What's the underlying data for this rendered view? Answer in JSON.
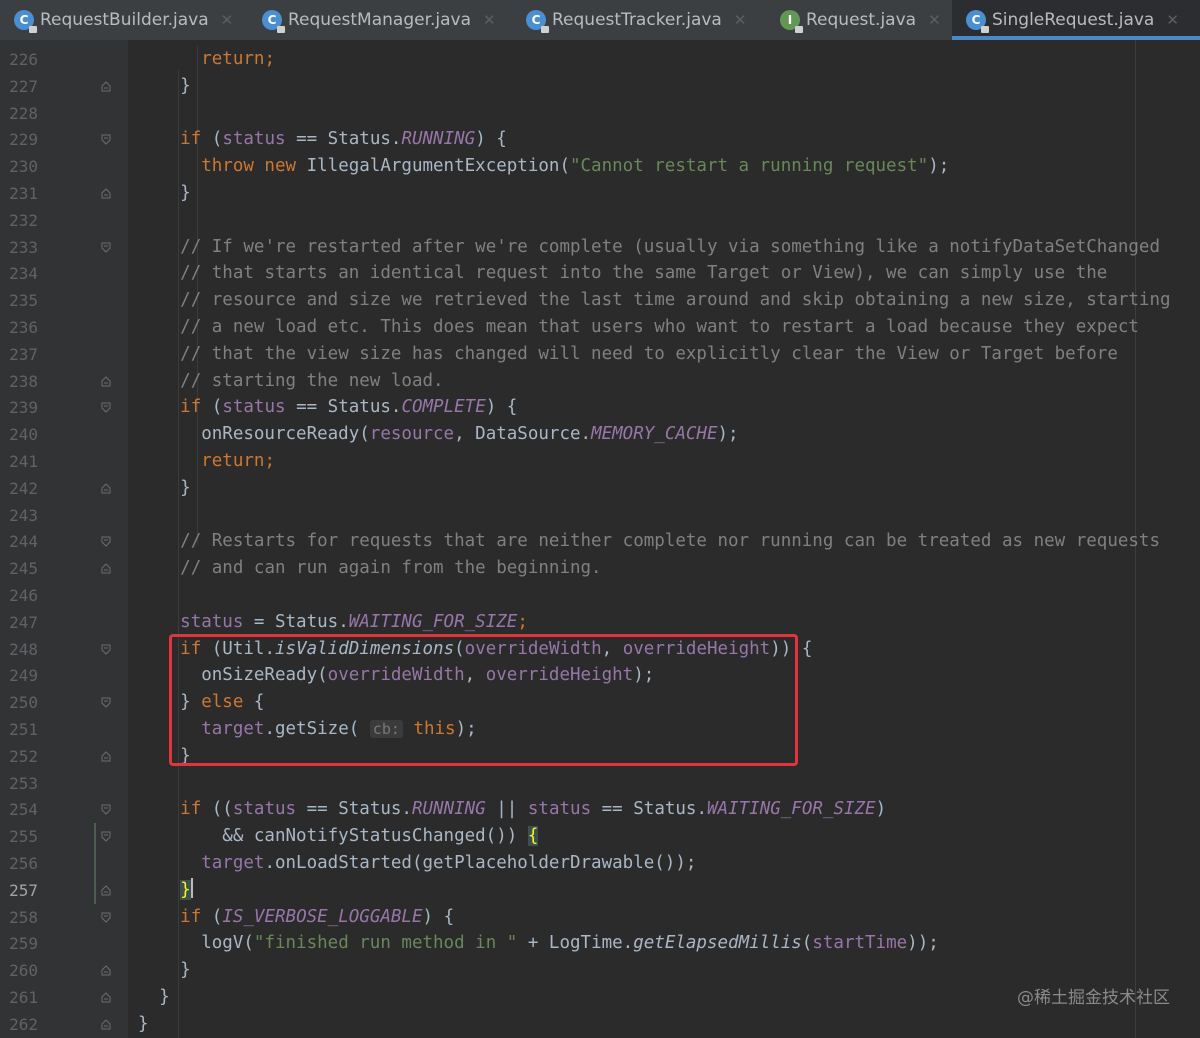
{
  "tabs": [
    {
      "label": "RequestBuilder.java",
      "icon": "class-icon",
      "icon_letter": "C",
      "active": false
    },
    {
      "label": "RequestManager.java",
      "icon": "class-icon",
      "icon_letter": "C",
      "active": false
    },
    {
      "label": "RequestTracker.java",
      "icon": "class-icon",
      "icon_letter": "C",
      "active": false
    },
    {
      "label": "Request.java",
      "icon": "interface-icon",
      "icon_letter": "I",
      "active": false
    },
    {
      "label": "SingleRequest.java",
      "icon": "class-icon",
      "icon_letter": "C",
      "active": true
    }
  ],
  "tab_close_glyph": "✕",
  "editor": {
    "current_line": 257,
    "lines": [
      {
        "num": "226",
        "tokens": [
          [
            "      ",
            ""
          ],
          [
            "return",
            "kw"
          ],
          [
            ";",
            "kw"
          ]
        ]
      },
      {
        "num": "227",
        "tokens": [
          [
            "    }",
            ""
          ]
        ]
      },
      {
        "num": "228",
        "tokens": []
      },
      {
        "num": "229",
        "tokens": [
          [
            "    ",
            ""
          ],
          [
            "if",
            "kw"
          ],
          [
            " (",
            ""
          ],
          [
            "status",
            "fld"
          ],
          [
            " == Status.",
            ""
          ],
          [
            "RUNNING",
            "sfld"
          ],
          [
            ") {",
            ""
          ]
        ]
      },
      {
        "num": "230",
        "tokens": [
          [
            "      ",
            ""
          ],
          [
            "throw new",
            "kw"
          ],
          [
            " IllegalArgumentException(",
            ""
          ],
          [
            "\"Cannot restart a running request\"",
            "str"
          ],
          [
            ");",
            ""
          ]
        ]
      },
      {
        "num": "231",
        "tokens": [
          [
            "    }",
            ""
          ]
        ]
      },
      {
        "num": "232",
        "tokens": []
      },
      {
        "num": "233",
        "tokens": [
          [
            "    ",
            ""
          ],
          [
            "// If we're restarted after we're complete (usually via something like a notifyDataSetChanged",
            "cmt"
          ]
        ]
      },
      {
        "num": "234",
        "tokens": [
          [
            "    ",
            ""
          ],
          [
            "// that starts an identical request into the same Target or View), we can simply use the",
            "cmt"
          ]
        ]
      },
      {
        "num": "235",
        "tokens": [
          [
            "    ",
            ""
          ],
          [
            "// resource and size we retrieved the last time around and skip obtaining a new size, starting",
            "cmt"
          ]
        ]
      },
      {
        "num": "236",
        "tokens": [
          [
            "    ",
            ""
          ],
          [
            "// a new load etc. This does mean that users who want to restart a load because they expect",
            "cmt"
          ]
        ]
      },
      {
        "num": "237",
        "tokens": [
          [
            "    ",
            ""
          ],
          [
            "// that the view size has changed will need to explicitly clear the View or Target before",
            "cmt"
          ]
        ]
      },
      {
        "num": "238",
        "tokens": [
          [
            "    ",
            ""
          ],
          [
            "// starting the new load.",
            "cmt"
          ]
        ]
      },
      {
        "num": "239",
        "tokens": [
          [
            "    ",
            ""
          ],
          [
            "if",
            "kw"
          ],
          [
            " (",
            ""
          ],
          [
            "status",
            "fld"
          ],
          [
            " == Status.",
            ""
          ],
          [
            "COMPLETE",
            "sfld"
          ],
          [
            ") {",
            ""
          ]
        ]
      },
      {
        "num": "240",
        "tokens": [
          [
            "      onResourceReady(",
            ""
          ],
          [
            "resource",
            "fld"
          ],
          [
            ", DataSource.",
            ""
          ],
          [
            "MEMORY_CACHE",
            "sfld"
          ],
          [
            ");",
            ""
          ]
        ]
      },
      {
        "num": "241",
        "tokens": [
          [
            "      ",
            ""
          ],
          [
            "return",
            "kw"
          ],
          [
            ";",
            "kw"
          ]
        ]
      },
      {
        "num": "242",
        "tokens": [
          [
            "    }",
            ""
          ]
        ]
      },
      {
        "num": "243",
        "tokens": []
      },
      {
        "num": "244",
        "tokens": [
          [
            "    ",
            ""
          ],
          [
            "// Restarts for requests that are neither complete nor running can be treated as new requests",
            "cmt"
          ]
        ]
      },
      {
        "num": "245",
        "tokens": [
          [
            "    ",
            ""
          ],
          [
            "// and can run again from the beginning.",
            "cmt"
          ]
        ]
      },
      {
        "num": "246",
        "tokens": []
      },
      {
        "num": "247",
        "tokens": [
          [
            "    ",
            ""
          ],
          [
            "status",
            "fld"
          ],
          [
            " = Status.",
            ""
          ],
          [
            "WAITING_FOR_SIZE",
            "sfld"
          ],
          [
            ";",
            "kw"
          ]
        ]
      },
      {
        "num": "248",
        "tokens": [
          [
            "    ",
            ""
          ],
          [
            "if",
            "kw"
          ],
          [
            " (Util.",
            ""
          ],
          [
            "isValidDimensions",
            "smeth"
          ],
          [
            "(",
            ""
          ],
          [
            "overrideWidth",
            "fld"
          ],
          [
            ", ",
            ""
          ],
          [
            "overrideHeight",
            "fld"
          ],
          [
            ")) {",
            ""
          ]
        ]
      },
      {
        "num": "249",
        "tokens": [
          [
            "      onSizeReady(",
            ""
          ],
          [
            "overrideWidth",
            "fld"
          ],
          [
            ", ",
            ""
          ],
          [
            "overrideHeight",
            "fld"
          ],
          [
            ");",
            ""
          ]
        ]
      },
      {
        "num": "250",
        "tokens": [
          [
            "    } ",
            ""
          ],
          [
            "else",
            "kw"
          ],
          [
            " {",
            ""
          ]
        ]
      },
      {
        "num": "251",
        "tokens": [
          [
            "      ",
            ""
          ],
          [
            "target",
            "fld"
          ],
          [
            ".getSize( ",
            ""
          ],
          [
            "cb:",
            "hint"
          ],
          [
            " ",
            ""
          ],
          [
            "this",
            "kw"
          ],
          [
            ");",
            ""
          ]
        ]
      },
      {
        "num": "252",
        "tokens": [
          [
            "    }",
            ""
          ]
        ]
      },
      {
        "num": "253",
        "tokens": []
      },
      {
        "num": "254",
        "tokens": [
          [
            "    ",
            ""
          ],
          [
            "if",
            "kw"
          ],
          [
            " ((",
            ""
          ],
          [
            "status",
            "fld"
          ],
          [
            " == Status.",
            ""
          ],
          [
            "RUNNING",
            "sfld"
          ],
          [
            " || ",
            ""
          ],
          [
            "status",
            "fld"
          ],
          [
            " == Status.",
            ""
          ],
          [
            "WAITING_FOR_SIZE",
            "sfld"
          ],
          [
            ")",
            ""
          ]
        ]
      },
      {
        "num": "255",
        "tokens": [
          [
            "        && canNotifyStatusChanged()) ",
            ""
          ],
          [
            "{",
            "brace-hl"
          ]
        ]
      },
      {
        "num": "256",
        "tokens": [
          [
            "      ",
            ""
          ],
          [
            "target",
            "fld"
          ],
          [
            ".onLoadStarted(getPlaceholderDrawable());",
            ""
          ]
        ]
      },
      {
        "num": "257",
        "tokens": [
          [
            "    ",
            ""
          ],
          [
            "}",
            "brace-hl"
          ],
          [
            "",
            "caret"
          ]
        ]
      },
      {
        "num": "258",
        "tokens": [
          [
            "    ",
            ""
          ],
          [
            "if",
            "kw"
          ],
          [
            " (",
            ""
          ],
          [
            "IS_VERBOSE_LOGGABLE",
            "sfld"
          ],
          [
            ") {",
            ""
          ]
        ]
      },
      {
        "num": "259",
        "tokens": [
          [
            "      logV(",
            ""
          ],
          [
            "\"finished run method in \"",
            "str"
          ],
          [
            " + LogTime.",
            ""
          ],
          [
            "getElapsedMillis",
            "smeth"
          ],
          [
            "(",
            ""
          ],
          [
            "startTime",
            "fld"
          ],
          [
            "));",
            ""
          ]
        ]
      },
      {
        "num": "260",
        "tokens": [
          [
            "    }",
            ""
          ]
        ]
      },
      {
        "num": "261",
        "tokens": [
          [
            "  }",
            ""
          ]
        ]
      },
      {
        "num": "262",
        "tokens": [
          [
            "}",
            ""
          ]
        ]
      }
    ]
  },
  "fold_markers": {
    "227": "end",
    "229": "start",
    "231": "end",
    "233": "start",
    "238": "end",
    "239": "start",
    "242": "end",
    "244": "start",
    "245": "end",
    "248": "start",
    "250": "start",
    "252": "end",
    "254": "start",
    "255": "start",
    "257": "end",
    "258": "start",
    "260": "end",
    "261": "end",
    "262": "end"
  },
  "change_marked_lines": [
    "255",
    "256",
    "257"
  ],
  "annotation": {
    "label": "highlighted-code-block",
    "color": "#e0353d",
    "covers_lines": [
      "248",
      "252"
    ]
  },
  "watermark": "@稀土掘金技术社区"
}
